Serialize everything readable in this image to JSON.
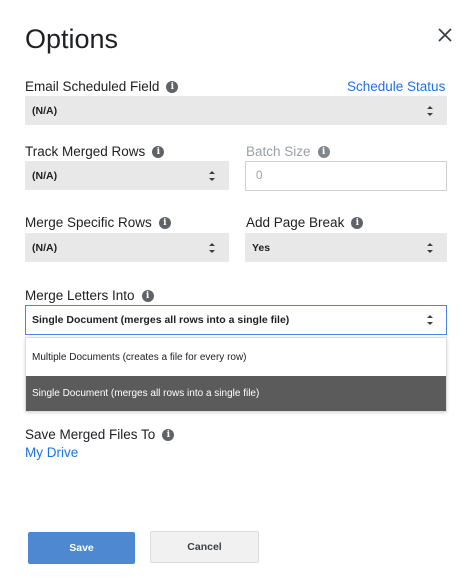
{
  "dialog": {
    "title": "Options"
  },
  "email_field": {
    "label": "Email Scheduled Field",
    "link": "Schedule Status",
    "value": "(N/A)"
  },
  "track_merged_rows": {
    "label": "Track Merged Rows",
    "value": "(N/A)"
  },
  "batch_size": {
    "label": "Batch Size",
    "placeholder": "0"
  },
  "merge_specific_rows": {
    "label": "Merge Specific Rows",
    "value": "(N/A)"
  },
  "add_page_break": {
    "label": "Add Page Break",
    "value": "Yes"
  },
  "merge_letters_into": {
    "label": "Merge Letters Into",
    "value": "Single Document (merges all rows into a single file)",
    "options": [
      "Multiple Documents (creates a file for every row)",
      "Single Document (merges all rows into a single file)"
    ],
    "selected_index": 1
  },
  "save_location": {
    "label": "Save Merged Files To",
    "link": "My Drive"
  },
  "buttons": {
    "save": "Save",
    "cancel": "Cancel"
  },
  "colors": {
    "accent": "#1a73e8",
    "save_button": "#4d88d0",
    "selected_option": "#5b5b5b",
    "focus_border": "#4a86e8"
  },
  "icons": {
    "close": "close-icon",
    "info": "info-icon",
    "select_arrow": "updown-arrows-icon"
  }
}
